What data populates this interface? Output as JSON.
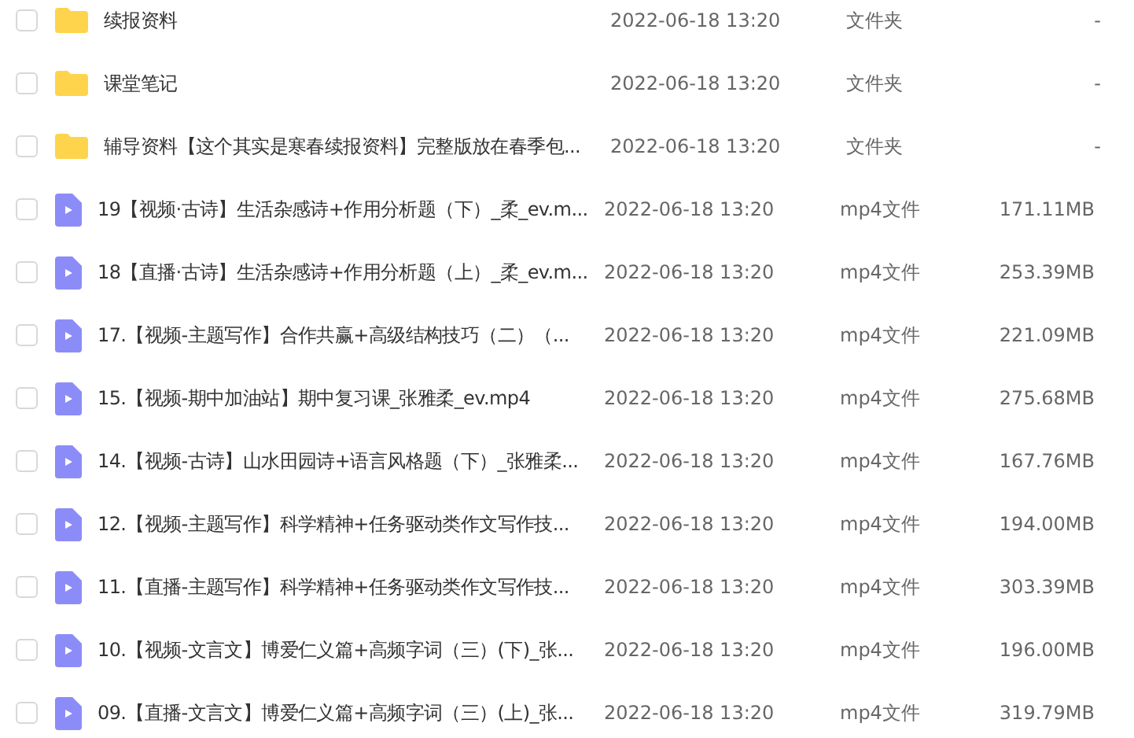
{
  "files": [
    {
      "kind": "folder",
      "checked": false,
      "name": "续报资料",
      "modified": "2022-06-18 13:20",
      "type": "文件夹",
      "size": "-"
    },
    {
      "kind": "folder",
      "checked": false,
      "name": "课堂笔记",
      "modified": "2022-06-18 13:20",
      "type": "文件夹",
      "size": "-"
    },
    {
      "kind": "folder",
      "checked": false,
      "name": "辅导资料【这个其实是寒春续报资料】完整版放在春季包...",
      "modified": "2022-06-18 13:20",
      "type": "文件夹",
      "size": "-"
    },
    {
      "kind": "video",
      "checked": false,
      "name": "19【视频·古诗】生活杂感诗+作用分析题（下）_柔_ev.m...",
      "modified": "2022-06-18 13:20",
      "type": "mp4文件",
      "size": "171.11MB"
    },
    {
      "kind": "video",
      "checked": false,
      "name": "18【直播·古诗】生活杂感诗+作用分析题（上）_柔_ev.m...",
      "modified": "2022-06-18 13:20",
      "type": "mp4文件",
      "size": "253.39MB"
    },
    {
      "kind": "video",
      "checked": false,
      "name": "17.【视频-主题写作】合作共赢+高级结构技巧（二）（...",
      "modified": "2022-06-18 13:20",
      "type": "mp4文件",
      "size": "221.09MB"
    },
    {
      "kind": "video",
      "checked": false,
      "name": "15.【视频-期中加油站】期中复习课_张雅柔_ev.mp4",
      "modified": "2022-06-18 13:20",
      "type": "mp4文件",
      "size": "275.68MB"
    },
    {
      "kind": "video",
      "checked": false,
      "name": "14.【视频-古诗】山水田园诗+语言风格题（下）_张雅柔...",
      "modified": "2022-06-18 13:20",
      "type": "mp4文件",
      "size": "167.76MB"
    },
    {
      "kind": "video",
      "checked": false,
      "name": "12.【视频-主题写作】科学精神+任务驱动类作文写作技...",
      "modified": "2022-06-18 13:20",
      "type": "mp4文件",
      "size": "194.00MB"
    },
    {
      "kind": "video",
      "checked": false,
      "name": "11.【直播-主题写作】科学精神+任务驱动类作文写作技...",
      "modified": "2022-06-18 13:20",
      "type": "mp4文件",
      "size": "303.39MB"
    },
    {
      "kind": "video",
      "checked": false,
      "name": "10.【视频-文言文】博爱仁义篇+高频字词（三）(下)_张...",
      "modified": "2022-06-18 13:20",
      "type": "mp4文件",
      "size": "196.00MB"
    },
    {
      "kind": "video",
      "checked": false,
      "name": "09.【直播-文言文】博爱仁义篇+高频字词（三）(上)_张...",
      "modified": "2022-06-18 13:20",
      "type": "mp4文件",
      "size": "319.79MB"
    }
  ]
}
